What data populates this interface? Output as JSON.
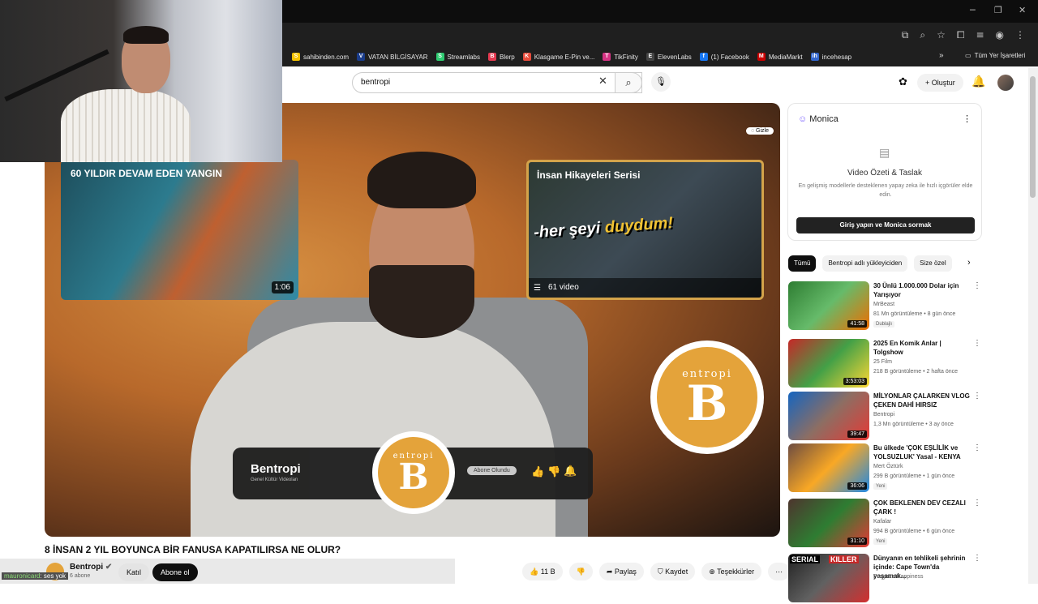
{
  "window": {
    "minimize": "─",
    "restore": "❐",
    "close": "✕"
  },
  "bookmarks": [
    {
      "icon": "S",
      "color": "#f5c400",
      "label": "sahibinden.com"
    },
    {
      "icon": "V",
      "color": "#1a3c8a",
      "label": "VATAN BİLGİSAYAR"
    },
    {
      "icon": "S",
      "color": "#2ecc71",
      "label": "Streamlabs"
    },
    {
      "icon": "B",
      "color": "#e53950",
      "label": "Blerp"
    },
    {
      "icon": "K",
      "color": "#e74c3c",
      "label": "Klasgame E-Pin ve..."
    },
    {
      "icon": "T",
      "color": "#d63384",
      "label": "TikFinity"
    },
    {
      "icon": "E",
      "color": "#444",
      "label": "ElevenLabs"
    },
    {
      "icon": "f",
      "color": "#1877f2",
      "label": "(1) Facebook"
    },
    {
      "icon": "M",
      "color": "#cc0000",
      "label": "MediaMarkt"
    },
    {
      "icon": "ih",
      "color": "#3366cc",
      "label": "incehesap"
    }
  ],
  "bookmarks_more": "»",
  "bookmarks_folder": "Tüm Yer İşaretleri",
  "search": {
    "query": "bentropi"
  },
  "header": {
    "create_label": "+ Oluştur"
  },
  "player": {
    "hide_label": "Gizle",
    "endcard_left": {
      "title": "60 YILDIR DEVAM EDEN YANGIN",
      "duration": "1:06"
    },
    "endcard_right": {
      "title": "İnsan Hikayeleri Serisi",
      "overlay_a": "-her şeyi ",
      "overlay_b": "duydum!",
      "playlist_count": "61 video"
    },
    "logo_word": "entropi",
    "logo_letter": "B",
    "subbar": {
      "channel": "Bentropi",
      "subtitle": "Genel Kültür Videoları",
      "subscribed": "Abone Olundu"
    }
  },
  "video": {
    "title": "8 İNSAN 2 YIL BOYUNCA BİR FANUSA KAPATILIRSA NE OLUR?"
  },
  "channel": {
    "name": "Bentropi",
    "subs": "6 abone",
    "join": "Katıl",
    "subscribe": "Abone ol"
  },
  "chat": {
    "user": "mauronicard",
    "message": ": ses yok"
  },
  "actions": {
    "like": "11 B",
    "share": "Paylaş",
    "save": "Kaydet",
    "thanks": "Teşekkürler",
    "more": "⋯"
  },
  "monica": {
    "title": "Monica",
    "heading": "Video Özeti & Taslak",
    "desc": "En gelişmiş modellerle desteklenen yapay zeka ile hızlı içgörüler elde edin.",
    "button": "Giriş yapın ve Monica sormak"
  },
  "chips": [
    "Tümü",
    "Bentropi adlı yükleyiciden",
    "Size özel"
  ],
  "recommendations": [
    {
      "title": "30 Ünlü 1.000.000 Dolar için Yarışıyor",
      "channel": "MrBeast",
      "meta": "81 Mn görüntüleme • 8 gün önce",
      "badge": "Dublajlı",
      "duration": "41:58",
      "thumb": "linear-gradient(135deg,#2e7d32,#66bb6a,#ef6c00)"
    },
    {
      "title": "2025 En Komik Anlar | Tolgshow",
      "channel": "25 Film",
      "meta": "218 B görüntüleme • 2 hafta önce",
      "badge": "",
      "duration": "3:53:03",
      "thumb": "linear-gradient(135deg,#c62828,#43a047,#fdd835)"
    },
    {
      "title": "MİLYONLAR ÇALARKEN VLOG ÇEKEN DAHİ HIRSIZ",
      "channel": "Bentropi",
      "meta": "1,3 Mn görüntüleme • 3 ay önce",
      "badge": "",
      "duration": "39:47",
      "thumb": "linear-gradient(135deg,#1565c0,#8d6e63,#e53935)"
    },
    {
      "title": "Bu ülkede 'ÇOK EŞLİLİK ve YOLSUZLUK' Yasal - KENYA",
      "channel": "Mert Öztürk",
      "meta": "299 B görüntüleme • 1 gün önce",
      "badge": "Yeni",
      "duration": "36:06",
      "thumb": "linear-gradient(135deg,#6d4c41,#f9a825,#1e88e5)"
    },
    {
      "title": "ÇOK BEKLENEN DEV CEZALI ÇARK !",
      "channel": "Kafalar",
      "meta": "994 B görüntüleme • 6 gün önce",
      "badge": "Yeni",
      "duration": "31:10",
      "thumb": "linear-gradient(135deg,#4e342e,#2e7d32,#e53935)"
    },
    {
      "title": "Dünyanın en tehlikeli şehrinin içinde: Cape Town'da yaşamak...",
      "channel": "Progetto Happiness",
      "meta": "",
      "badge": "",
      "duration": "",
      "thumb": "linear-gradient(135deg,#212121,#616161,#d32f2f)"
    }
  ],
  "recommendation_labels": {
    "serial": "SERIAL",
    "killer": "KILLER"
  }
}
